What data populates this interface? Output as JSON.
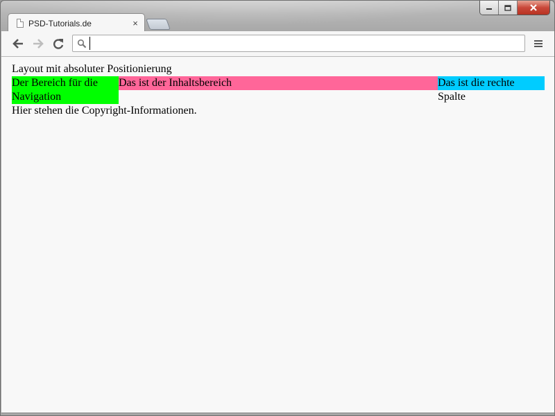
{
  "window": {
    "controls": {
      "minimize_icon": "minimize-icon",
      "maximize_icon": "maximize-icon",
      "close_icon": "close-icon"
    }
  },
  "tabs": [
    {
      "title": "PSD-Tutorials.de",
      "icon": "page-icon",
      "close_icon": "×",
      "active": true
    }
  ],
  "toolbar": {
    "back_icon": "arrow-left-icon",
    "forward_icon": "arrow-right-icon",
    "reload_icon": "reload-icon",
    "address": {
      "value": "",
      "placeholder": "",
      "icon": "search-icon"
    },
    "menu_icon": "hamburger-menu-icon"
  },
  "page": {
    "heading": "Layout mit absoluter Positionierung",
    "navigation": "Der Bereich für die Navigation",
    "content": "Das ist der Inhaltsbereich",
    "right_column": "Das ist die rechte Spalte",
    "copyright": "Hier stehen die Copyright-Informationen.",
    "colors": {
      "navigation_bg": "#00ff00",
      "content_bg": "#ff6699",
      "right_column_bg": "#00ccff"
    }
  }
}
